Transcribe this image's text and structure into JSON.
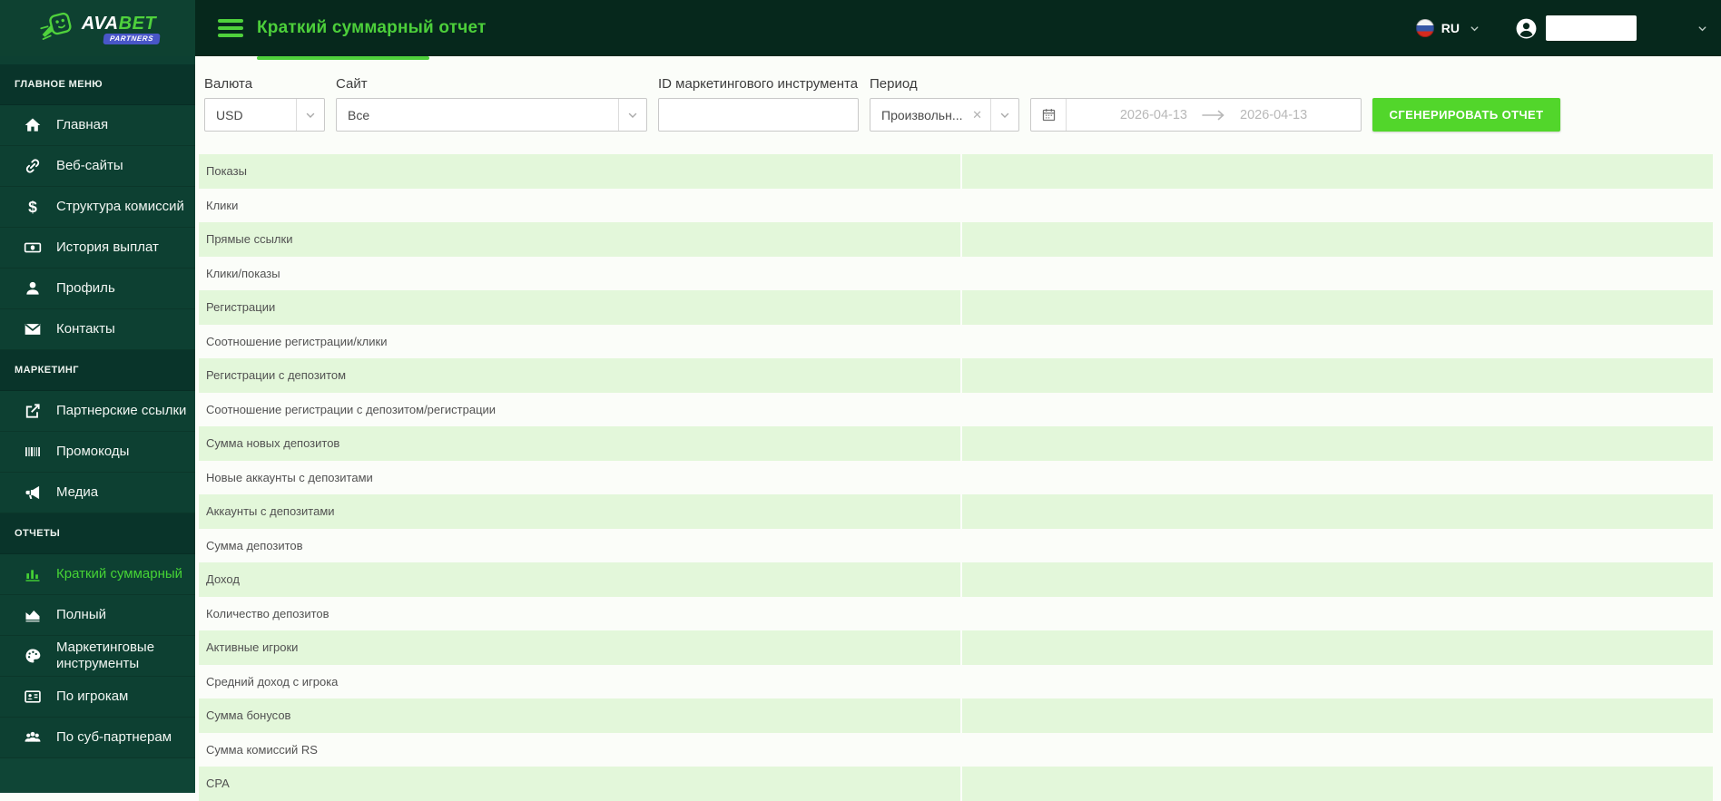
{
  "brand": {
    "logo_prefix": "AVA",
    "logo_suffix": "BET",
    "badge": "PARTNERS"
  },
  "header": {
    "title": "Краткий суммарный отчет",
    "language_code": "RU"
  },
  "sidebar": {
    "groups": [
      {
        "label": "ГЛАВНОЕ МЕНЮ",
        "items": [
          {
            "icon": "home",
            "label": "Главная"
          },
          {
            "icon": "link",
            "label": "Веб-сайты"
          },
          {
            "icon": "dollar",
            "label": "Структура комиссий"
          },
          {
            "icon": "banknote",
            "label": "История выплат"
          },
          {
            "icon": "person",
            "label": "Профиль"
          },
          {
            "icon": "envelope",
            "label": "Контакты"
          }
        ]
      },
      {
        "label": "МАРКЕТИНГ",
        "items": [
          {
            "icon": "external-link",
            "label": "Партнерские ссылки"
          },
          {
            "icon": "barcode",
            "label": "Промокоды"
          },
          {
            "icon": "megaphone",
            "label": "Медиа"
          }
        ]
      },
      {
        "label": "ОТЧЕТЫ",
        "items": [
          {
            "icon": "bar-chart",
            "label": "Краткий суммарный",
            "active": true
          },
          {
            "icon": "area-chart",
            "label": "Полный"
          },
          {
            "icon": "palette",
            "label": "Маркетинговые инструменты"
          },
          {
            "icon": "id-card",
            "label": "По игрокам"
          },
          {
            "icon": "people",
            "label": "По суб-партнерам"
          }
        ]
      }
    ]
  },
  "filters": {
    "currency": {
      "label": "Валюта",
      "value": "USD"
    },
    "site": {
      "label": "Сайт",
      "value": "Все"
    },
    "marketing_tool": {
      "label": "ID маркетингового инструмента",
      "value": ""
    },
    "period": {
      "label": "Период",
      "value": "Произвольн...",
      "clear_glyph": "✕"
    },
    "date_range": {
      "start": "2026-04-13",
      "end": "2026-04-13"
    },
    "generate_button": "СГЕНЕРИРОВАТЬ ОТЧЕТ"
  },
  "report": {
    "metrics": [
      "Показы",
      "Клики",
      "Прямые ссылки",
      "Клики/показы",
      "Регистрации",
      "Соотношение регистрации/клики",
      "Регистрации с депозитом",
      "Соотношение регистрации с депозитом/регистрации",
      "Сумма новых депозитов",
      "Новые аккаунты с депозитами",
      "Аккаунты с депозитами",
      "Сумма депозитов",
      "Доход",
      "Количество депозитов",
      "Активные игроки",
      "Средний доход с игрока",
      "Сумма бонусов",
      "Сумма комиссий RS",
      "CPA"
    ],
    "values": []
  },
  "colors": {
    "accent_green": "#4fd13c",
    "button_green": "#52d62b",
    "row_green": "#e3f7da",
    "sidebar_bg": "#0d4032",
    "topbar_bg": "#06281c",
    "badge_blue": "#4956c8"
  }
}
